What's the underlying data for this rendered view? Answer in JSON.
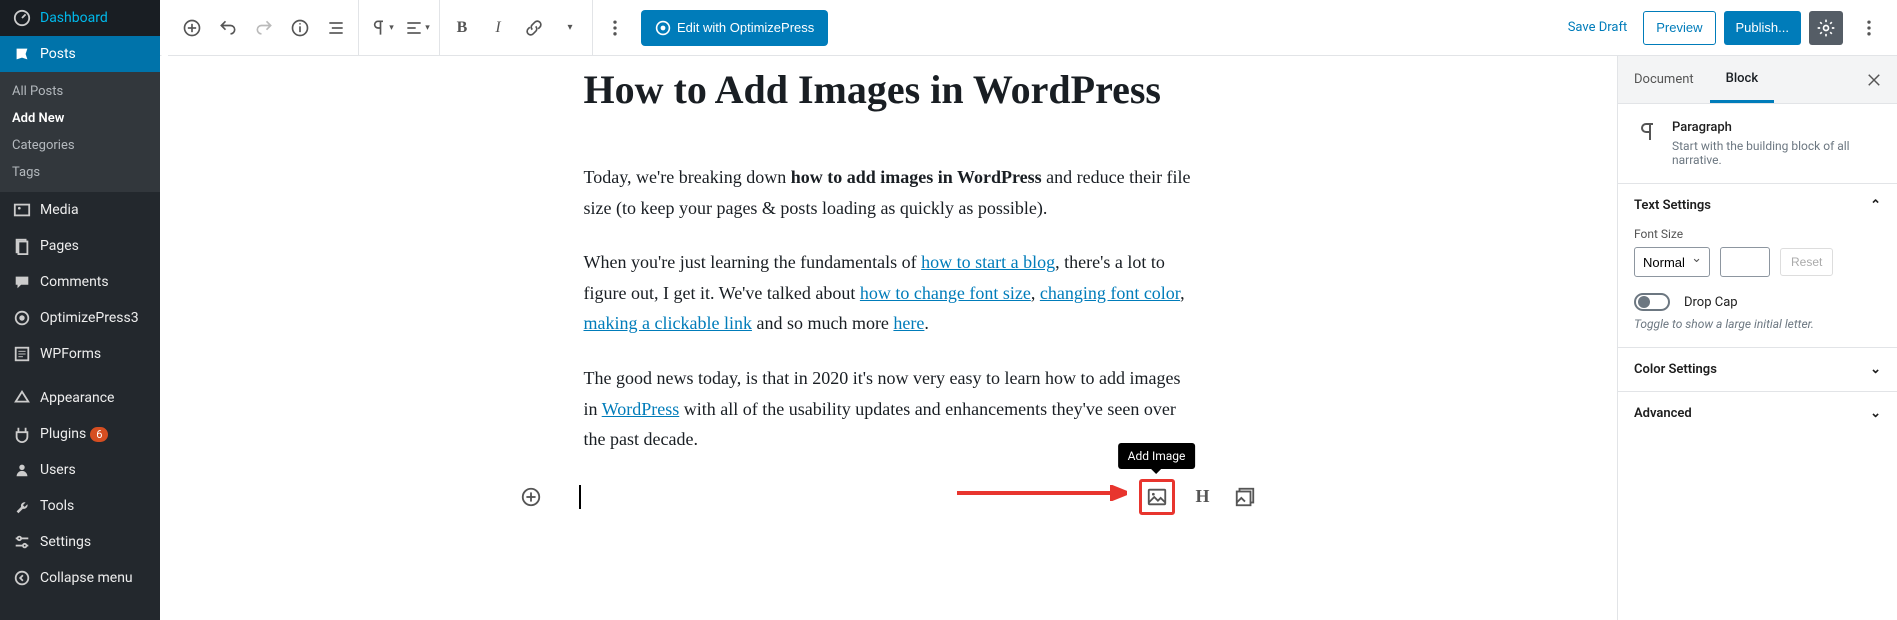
{
  "sidebar": {
    "dashboard": "Dashboard",
    "posts": "Posts",
    "posts_sub": [
      {
        "label": "All Posts"
      },
      {
        "label": "Add New"
      },
      {
        "label": "Categories"
      },
      {
        "label": "Tags"
      }
    ],
    "media": "Media",
    "pages": "Pages",
    "comments": "Comments",
    "optimizepress": "OptimizePress3",
    "wpforms": "WPForms",
    "appearance": "Appearance",
    "plugins": "Plugins",
    "plugins_count": "6",
    "users": "Users",
    "tools": "Tools",
    "settings": "Settings",
    "collapse": "Collapse menu"
  },
  "toolbar": {
    "edit_op": "Edit with OptimizePress",
    "save_draft": "Save Draft",
    "preview": "Preview",
    "publish": "Publish..."
  },
  "post": {
    "title": "How to Add Images in WordPress",
    "p1_pre": "Today, we're breaking down ",
    "p1_bold": "how to add images in WordPress",
    "p1_post": " and reduce their file size (to keep your pages & posts loading as quickly as possible).",
    "p2_pre": "When you're just learning the fundamentals of ",
    "p2_link1": "how to start a blog",
    "p2_mid1": ", there's a lot to figure out, I get it. We've talked about ",
    "p2_link2": "how to change font size",
    "p2_mid2": ", ",
    "p2_link3": "changing font color",
    "p2_mid3": ", ",
    "p2_link4": "making a clickable link",
    "p2_mid4": " and so much more ",
    "p2_link5": "here",
    "p2_end": ".",
    "p3_pre": "The good news today, is that in 2020 it's now very easy to learn how to add images in ",
    "p3_link": "WordPress",
    "p3_post": " with all of the usability updates and enhancements they've seen over the past decade."
  },
  "insert": {
    "tooltip": "Add Image"
  },
  "inspector": {
    "tab_document": "Document",
    "tab_block": "Block",
    "block_name": "Paragraph",
    "block_desc": "Start with the building block of all narrative.",
    "text_settings": "Text Settings",
    "font_size_label": "Font Size",
    "font_size_value": "Normal",
    "reset": "Reset",
    "drop_cap": "Drop Cap",
    "drop_cap_hint": "Toggle to show a large initial letter.",
    "color_settings": "Color Settings",
    "advanced": "Advanced"
  }
}
